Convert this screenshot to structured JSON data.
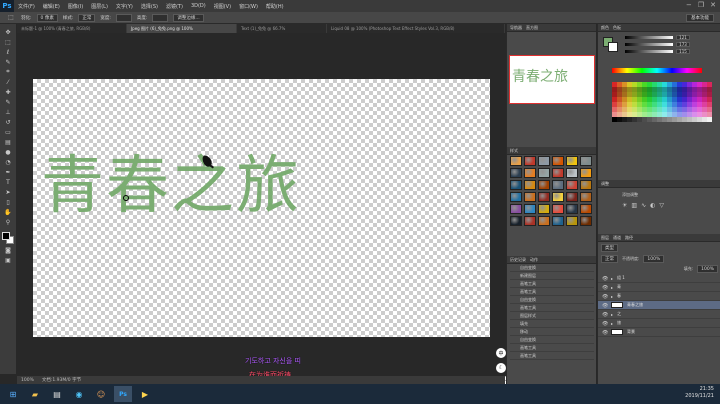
{
  "app": {
    "logo": "Ps"
  },
  "menu": [
    "文件(F)",
    "编辑(E)",
    "图像(I)",
    "图层(L)",
    "文字(Y)",
    "选择(S)",
    "滤镜(T)",
    "3D(D)",
    "视图(V)",
    "窗口(W)",
    "帮助(H)"
  ],
  "window_controls": {
    "minimize": "−",
    "restore": "❐",
    "close": "✕"
  },
  "options": {
    "feather_label": "羽化:",
    "feather_value": "0 像素",
    "style_label": "样式:",
    "style_value": "正常",
    "width_label": "宽度:",
    "height_label": "高度:",
    "refine_edge": "调整边缘...",
    "workspace": "基本功能"
  },
  "tabs": [
    {
      "label": "未标题-1 @ 100% (青春之旅, RGB/8)"
    },
    {
      "label": "Jpeg 图片 (6)_兔兔.png @ 100%"
    },
    {
      "label": "Text (1)_兔兔 @ 66.7%"
    },
    {
      "label": "Liquid 08 @ 100% (Photoshop Text Effect Styles Vol.3, RGB/8)"
    }
  ],
  "canvas": {
    "title_text": "青春之旅"
  },
  "subtitles": {
    "line1": "기도하고 자신을 띠",
    "line2": "在为谁而祈祷"
  },
  "floating_button": {
    "top_label": "中"
  },
  "status": {
    "zoom": "100%",
    "doc": "文档:1.93M/0 字节"
  },
  "navigator": {
    "tabs": [
      "导航器",
      "直方图"
    ],
    "thumb_text": "青春之旅"
  },
  "styles": {
    "tab": "样式"
  },
  "history": {
    "tabs": [
      "历史记录",
      "动作"
    ],
    "items": [
      "自由变换",
      "新建图层",
      "画笔工具",
      "画笔工具",
      "自由变换",
      "画笔工具",
      "图层样式",
      "填充",
      "移动",
      "自由变换",
      "画笔工具",
      "画笔工具"
    ]
  },
  "color_panel": {
    "tabs": [
      "颜色",
      "色板"
    ],
    "r": "121",
    "g": "173",
    "b": "115"
  },
  "adjustments": {
    "tab": "调整",
    "label": "添加调整"
  },
  "layers": {
    "tabs": [
      "图层",
      "通道",
      "路径"
    ],
    "kind_label": "类型",
    "blend_mode": "正常",
    "opacity_label": "不透明度:",
    "opacity": "100%",
    "fill_label": "填充:",
    "fill": "100%",
    "rows": [
      {
        "name": "组 1",
        "selected": false
      },
      {
        "name": "青",
        "selected": false
      },
      {
        "name": "春",
        "selected": false
      },
      {
        "name": "青春之旅",
        "selected": true
      },
      {
        "name": "之",
        "selected": false
      },
      {
        "name": "旅",
        "selected": false
      },
      {
        "name": "背景",
        "selected": false
      }
    ]
  },
  "clock": {
    "time": "21:35",
    "date": "2019/11/21"
  },
  "colors": {
    "accent_green": "#7bad72",
    "selection_red": "#e03030",
    "layer_selected": "#5d6b85"
  }
}
